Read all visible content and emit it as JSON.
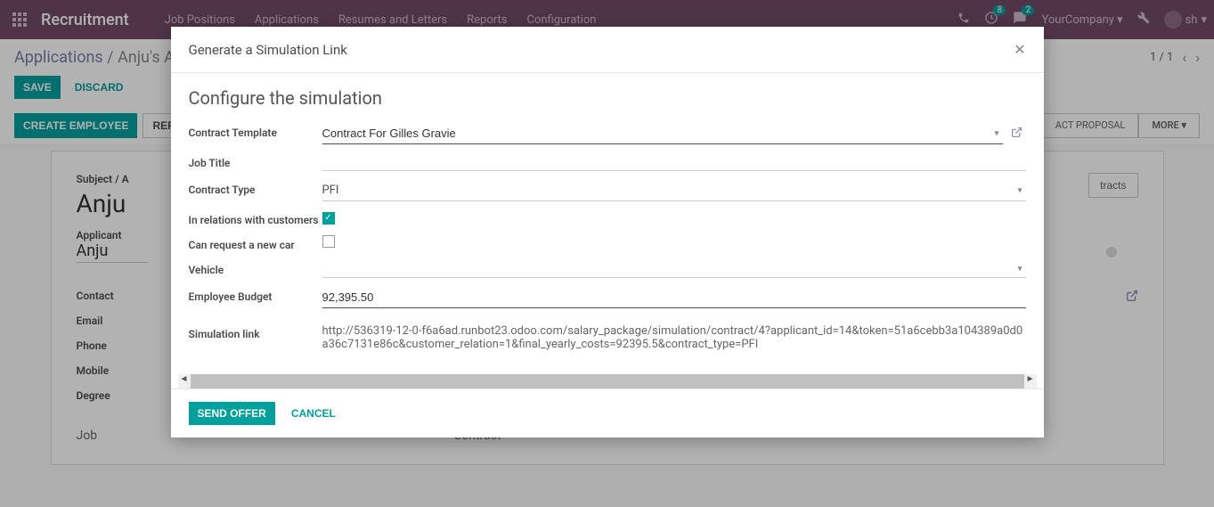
{
  "header": {
    "app_title": "Recruitment",
    "nav": [
      "Job Positions",
      "Applications",
      "Resumes and Letters",
      "Reports",
      "Configuration"
    ],
    "badge1": "8",
    "badge2": "2",
    "company": "YourCompany",
    "user": "sh"
  },
  "breadcrumb": {
    "root": "Applications",
    "current": "Anju's A"
  },
  "actions": {
    "save": "SAVE",
    "discard": "DISCARD",
    "create_employee": "CREATE EMPLOYEE",
    "refuse": "REFU"
  },
  "pager": {
    "text": "1 / 1"
  },
  "status": {
    "pill1": "ACT PROPOSAL",
    "more": "MORE"
  },
  "sheet": {
    "contracts_btn": "tracts",
    "subject_label": "Subject / A",
    "subject_value": "Anju",
    "applicant_label": "Applicant",
    "applicant_value": "Anju",
    "contact": "Contact",
    "email": "Email",
    "phone": "Phone",
    "mobile": "Mobile",
    "degree": "Degree",
    "job_section": "Job",
    "contract_section": "Contract"
  },
  "modal": {
    "title": "Generate a Simulation Link",
    "subtitle": "Configure the simulation",
    "labels": {
      "contract_template": "Contract Template",
      "job_title": "Job Title",
      "contract_type": "Contract Type",
      "relations": "In relations with customers",
      "new_car": "Can request a new car",
      "vehicle": "Vehicle",
      "employee_budget": "Employee Budget",
      "sim_link": "Simulation link"
    },
    "values": {
      "contract_template": "Contract For Gilles Gravie",
      "job_title": "",
      "contract_type": "PFI",
      "relations_checked": true,
      "new_car_checked": false,
      "vehicle": "",
      "employee_budget": "92,395.50",
      "sim_link": "http://536319-12-0-f6a6ad.runbot23.odoo.com/salary_package/simulation/contract/4?applicant_id=14&token=51a6cebb3a104389a0d0a36c7131e86c&customer_relation=1&final_yearly_costs=92395.5&contract_type=PFI"
    },
    "footer": {
      "send": "SEND OFFER",
      "cancel": "CANCEL"
    }
  }
}
